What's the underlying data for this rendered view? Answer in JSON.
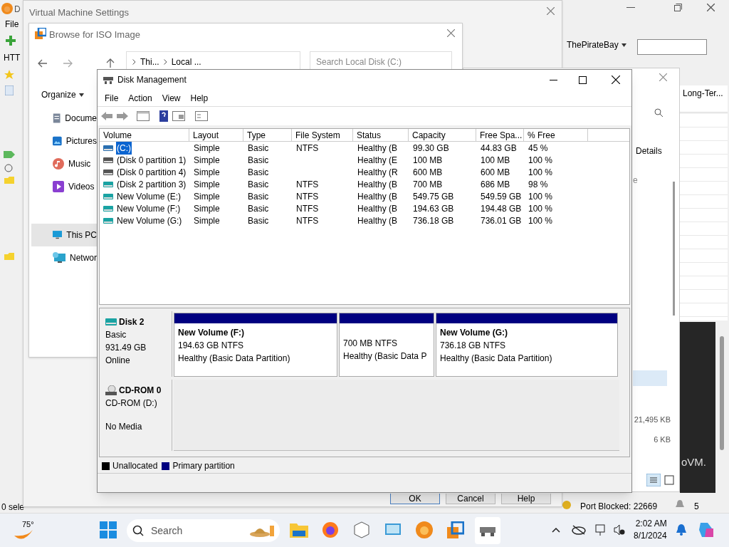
{
  "background_app": {
    "title": "D",
    "menu": [
      "File"
    ],
    "toolbar_label": "HTT",
    "search_engine": "ThePirateBay",
    "column_header": "Long-Ter...",
    "status_left": "0 sele",
    "port_status": "Port Blocked: 22669",
    "alerts": "5",
    "panel_text": "oVM."
  },
  "middle_window": {
    "tab": "Details",
    "column_fragment": "e",
    "sizes": [
      "21,495 KB",
      "6 KB"
    ]
  },
  "vm_settings": {
    "title": "Virtual Machine Settings",
    "buttons": [
      "OK",
      "Cancel",
      "Help"
    ]
  },
  "browse_dialog": {
    "title": "Browse for ISO Image",
    "path": [
      "Thi...",
      "Local ..."
    ],
    "search_placeholder": "Search Local Disk (C:)",
    "organize": "Organize",
    "nav": [
      {
        "label": "Docume",
        "kind": "documents",
        "selected": false
      },
      {
        "label": "Pictures",
        "kind": "pictures",
        "selected": false
      },
      {
        "label": "Music",
        "kind": "music",
        "selected": false
      },
      {
        "label": "Videos",
        "kind": "videos",
        "selected": false
      },
      {
        "label": "This PC",
        "kind": "pc",
        "selected": true
      },
      {
        "label": "Networ",
        "kind": "network",
        "selected": false
      }
    ]
  },
  "disk_management": {
    "title": "Disk Management",
    "menu": [
      "File",
      "Action",
      "View",
      "Help"
    ],
    "columns": [
      "Volume",
      "Layout",
      "Type",
      "File System",
      "Status",
      "Capacity",
      "Free Spa...",
      "% Free"
    ],
    "rows": [
      {
        "kind": "system",
        "selected": true,
        "cells": [
          "(C:)",
          "Simple",
          "Basic",
          "NTFS",
          "Healthy (B",
          "99.30 GB",
          "44.83 GB",
          "45 %"
        ]
      },
      {
        "kind": "hidden",
        "selected": false,
        "cells": [
          "(Disk 0 partition 1)",
          "Simple",
          "Basic",
          "",
          "Healthy (E",
          "100 MB",
          "100 MB",
          "100 %"
        ]
      },
      {
        "kind": "hidden",
        "selected": false,
        "cells": [
          "(Disk 0 partition 4)",
          "Simple",
          "Basic",
          "",
          "Healthy (R",
          "600 MB",
          "600 MB",
          "100 %"
        ]
      },
      {
        "kind": "data",
        "selected": false,
        "cells": [
          "(Disk 2 partition 3)",
          "Simple",
          "Basic",
          "NTFS",
          "Healthy (B",
          "700 MB",
          "686 MB",
          "98 %"
        ]
      },
      {
        "kind": "data",
        "selected": false,
        "cells": [
          "New Volume (E:)",
          "Simple",
          "Basic",
          "NTFS",
          "Healthy (B",
          "549.75 GB",
          "549.59 GB",
          "100 %"
        ]
      },
      {
        "kind": "data",
        "selected": false,
        "cells": [
          "New Volume (F:)",
          "Simple",
          "Basic",
          "NTFS",
          "Healthy (B",
          "194.63 GB",
          "194.48 GB",
          "100 %"
        ]
      },
      {
        "kind": "data",
        "selected": false,
        "cells": [
          "New Volume (G:)",
          "Simple",
          "Basic",
          "NTFS",
          "Healthy (B",
          "736.18 GB",
          "736.01 GB",
          "100 %"
        ]
      }
    ],
    "disks": [
      {
        "kind": "disk",
        "name": "Disk 2",
        "lines": [
          "Basic",
          "931.49 GB",
          "Online"
        ],
        "partitions": [
          {
            "title": "New Volume  (F:)",
            "size": "194.63 GB NTFS",
            "status": "Healthy (Basic Data Partition)"
          },
          {
            "size": "700 MB NTFS",
            "status": "Healthy (Basic Data P"
          },
          {
            "title": "New Volume  (G:)",
            "size": "736.18 GB NTFS",
            "status": "Healthy (Basic Data Partition)"
          }
        ]
      },
      {
        "kind": "cdrom",
        "name": "CD-ROM 0",
        "lines": [
          "CD-ROM (D:)",
          "No Media"
        ]
      }
    ],
    "legend": [
      {
        "label": "Unallocated",
        "color": "#000000"
      },
      {
        "label": "Primary partition",
        "color": "#000080"
      }
    ]
  },
  "taskbar": {
    "weather": "75°",
    "search": "Search",
    "time": "2:02 AM",
    "date": "8/1/2024"
  }
}
